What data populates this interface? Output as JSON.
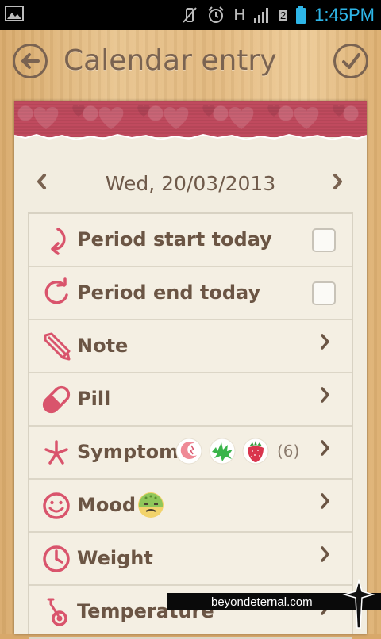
{
  "status_bar": {
    "time": "1:45PM",
    "network_label": "H",
    "sim_badge": "2",
    "icons": [
      "gallery-icon",
      "vibrate-off-icon",
      "alarm-icon",
      "signal-icon",
      "battery-icon"
    ]
  },
  "header": {
    "title": "Calendar entry",
    "back_icon": "arrow-left-icon",
    "confirm_icon": "checkmark-icon"
  },
  "date_nav": {
    "date": "Wed, 20/03/2013",
    "prev_icon": "chevron-left-icon",
    "next_icon": "chevron-right-icon"
  },
  "rows": [
    {
      "label": "Period start today",
      "icon": "period-start-icon",
      "control": "checkbox",
      "checked": false
    },
    {
      "label": "Period end today",
      "icon": "period-end-icon",
      "control": "checkbox",
      "checked": false
    },
    {
      "label": "Note",
      "icon": "pencil-icon",
      "control": "chevron"
    },
    {
      "label": "Pill",
      "icon": "pill-icon",
      "control": "chevron"
    },
    {
      "label": "Symptom",
      "icon": "asterisk-icon",
      "control": "chevron",
      "count": "(6)"
    },
    {
      "label": "Mood",
      "icon": "smiley-icon",
      "control": "chevron"
    },
    {
      "label": "Weight",
      "icon": "clock-icon",
      "control": "chevron"
    },
    {
      "label": "Temperature",
      "icon": "thermometer-icon",
      "control": "chevron"
    }
  ],
  "watermark": {
    "text": "beyondeternal.com"
  },
  "colors": {
    "accent": "#d9546c",
    "text": "#6b5544",
    "ribbon": "#c04a5e",
    "paper": "#f2ede0",
    "status_time": "#2eb6e8"
  }
}
